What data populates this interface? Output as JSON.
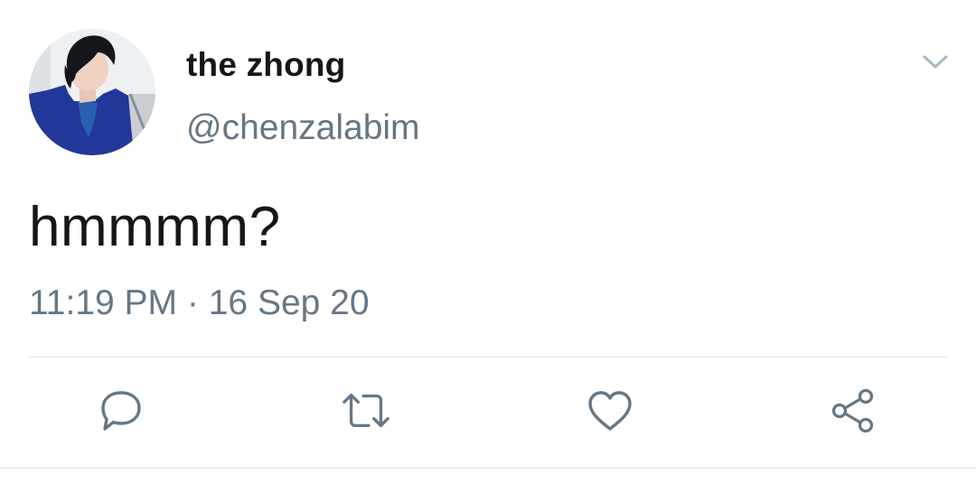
{
  "tweet": {
    "display_name": "the zhong",
    "handle": "@chenzalabim",
    "text": "hmmmm?",
    "time": "11:19 PM",
    "separator": "·",
    "date": "16 Sep 20"
  },
  "icons": {
    "avatar": "profile-photo",
    "caret": "chevron-down-icon",
    "reply": "reply-icon",
    "retweet": "retweet-icon",
    "like": "heart-icon",
    "share": "share-icon"
  },
  "colors": {
    "text_primary": "#14171a",
    "text_secondary": "#657786",
    "icon": "#657786",
    "divider": "#dfe4e8"
  }
}
